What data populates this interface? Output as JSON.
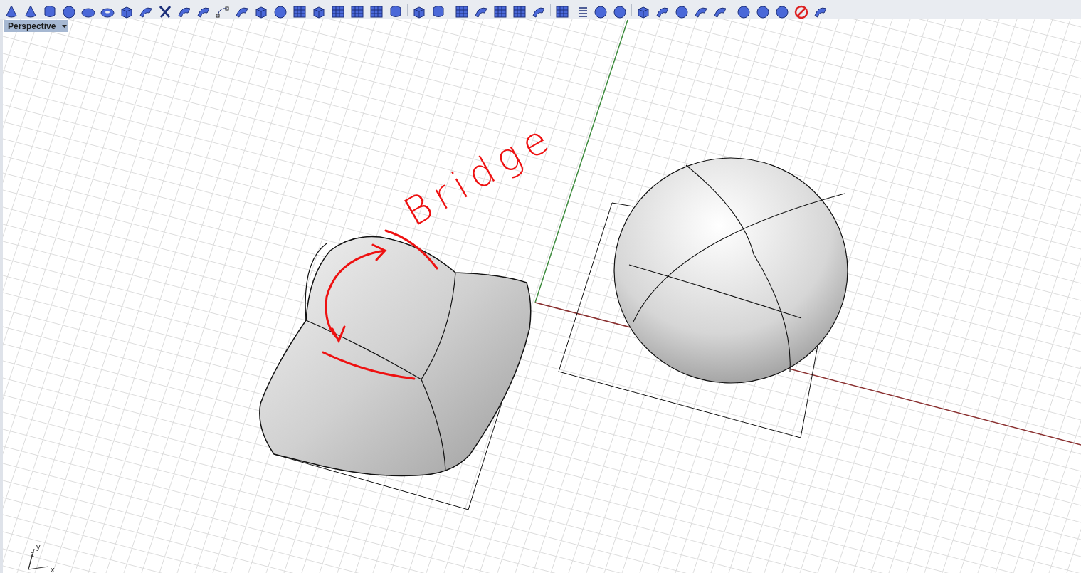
{
  "viewport": {
    "title": "Perspective",
    "annotation": "Bridge",
    "axis_labels": [
      "y",
      "z",
      "x"
    ]
  }
}
